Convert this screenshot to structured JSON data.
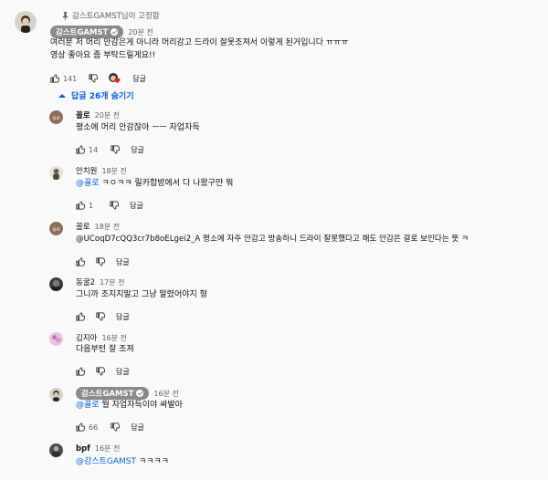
{
  "pinned": {
    "label": "감스트GAMST님이 고정함",
    "icon": "pin-icon"
  },
  "main_comment": {
    "author": "감스트GAMST",
    "time": "20분 전",
    "line1": "여러분 저 머리 안감은게 아니라 머리감고 드라이 잘못조져서 이렇게 된거입니다 ㅠㅠㅠ",
    "line2": "영상 좋아요 좀 부탁드릴게요!!",
    "likes": "141",
    "reply_label": "답글"
  },
  "replies_toggle": {
    "label": "답글 26개 숨기기",
    "icon": "chevron-up-icon"
  },
  "replies": [
    {
      "author": "꼴로",
      "time": "20분 전",
      "text": "평소에 머리 안감잖아 ㅡㅡ 자업자득",
      "likes": "14",
      "reply_label": "답글"
    },
    {
      "author": "안치원",
      "time": "18분 전",
      "mention": "@꼴로",
      "text": "ㅋㅇㅋㅋ 릴카합방에서 다 나왔구만 뭐",
      "likes": "1",
      "reply_label": "답글"
    },
    {
      "author": "꼴로",
      "time": "18분 전",
      "mention": "@UCoqD7cQQ3cr7b8oELgei2_A",
      "text": "평소에 자주 안감고 방송하니 드라이 잘못했다고 해도 안감은 걸로 보인다는 뜻 ㅋ",
      "likes": "",
      "reply_label": "답글"
    },
    {
      "author": "동굴2",
      "time": "17분 전",
      "text": "그니까 조지지말고 그냥 말렸어야지 형",
      "likes": "",
      "reply_label": "답글"
    },
    {
      "author": "김지아",
      "time": "16분 전",
      "text": "다음부턴 잘 조져",
      "likes": "",
      "reply_label": "답글"
    },
    {
      "author": "감스트GAMST",
      "time": "16분 전",
      "mention": "@꼴로",
      "text": "뭘 자업자득이야 싸발아",
      "likes": "66",
      "reply_label": "답글"
    },
    {
      "author": "bpf",
      "time": "16분 전",
      "mention": "@감스트GAMST",
      "text": "ㅋㅋㅋㅋ",
      "likes": "",
      "reply_label": "답글"
    }
  ],
  "colors": {
    "link": "#065fd4",
    "muted": "#606060",
    "heart": "#e62117",
    "chip": "#8a8a8a"
  }
}
